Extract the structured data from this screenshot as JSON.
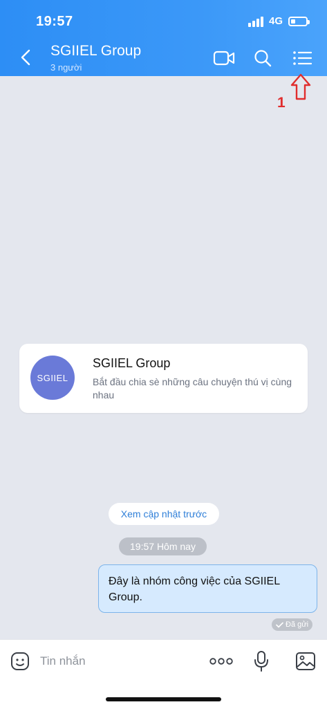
{
  "status_bar": {
    "time": "19:57",
    "network": "4G",
    "battery_level": 0.3
  },
  "header": {
    "title": "SGIIEL Group",
    "subtitle": "3 người",
    "icons": [
      "back-icon",
      "video-call-icon",
      "search-icon",
      "menu-list-icon"
    ]
  },
  "annotation": {
    "label": "1",
    "color": "#e02d2d"
  },
  "group_card": {
    "avatar_text": "SGIIEL",
    "name": "SGIIEL Group",
    "description": "Bắt đầu chia sè những câu chuyện thú vị cùng nhau"
  },
  "timeline": {
    "view_older": "Xem cập nhật trước",
    "time_divider": "19:57 Hôm nay"
  },
  "message": {
    "text": "Đây là nhóm công việc của SGIIEL Group.",
    "status": "Đã gửi"
  },
  "composer": {
    "placeholder": "Tin nhắn",
    "value": "",
    "icons": [
      "emoji-icon",
      "more-icon",
      "microphone-icon",
      "image-icon"
    ]
  },
  "colors": {
    "header_gradient_start": "#2d8ef5",
    "header_gradient_end": "#4aa3fb",
    "background": "#e4e7ee",
    "bubble": "#d6eafe",
    "link": "#2f7fd8",
    "avatar": "#6a7ad8"
  }
}
